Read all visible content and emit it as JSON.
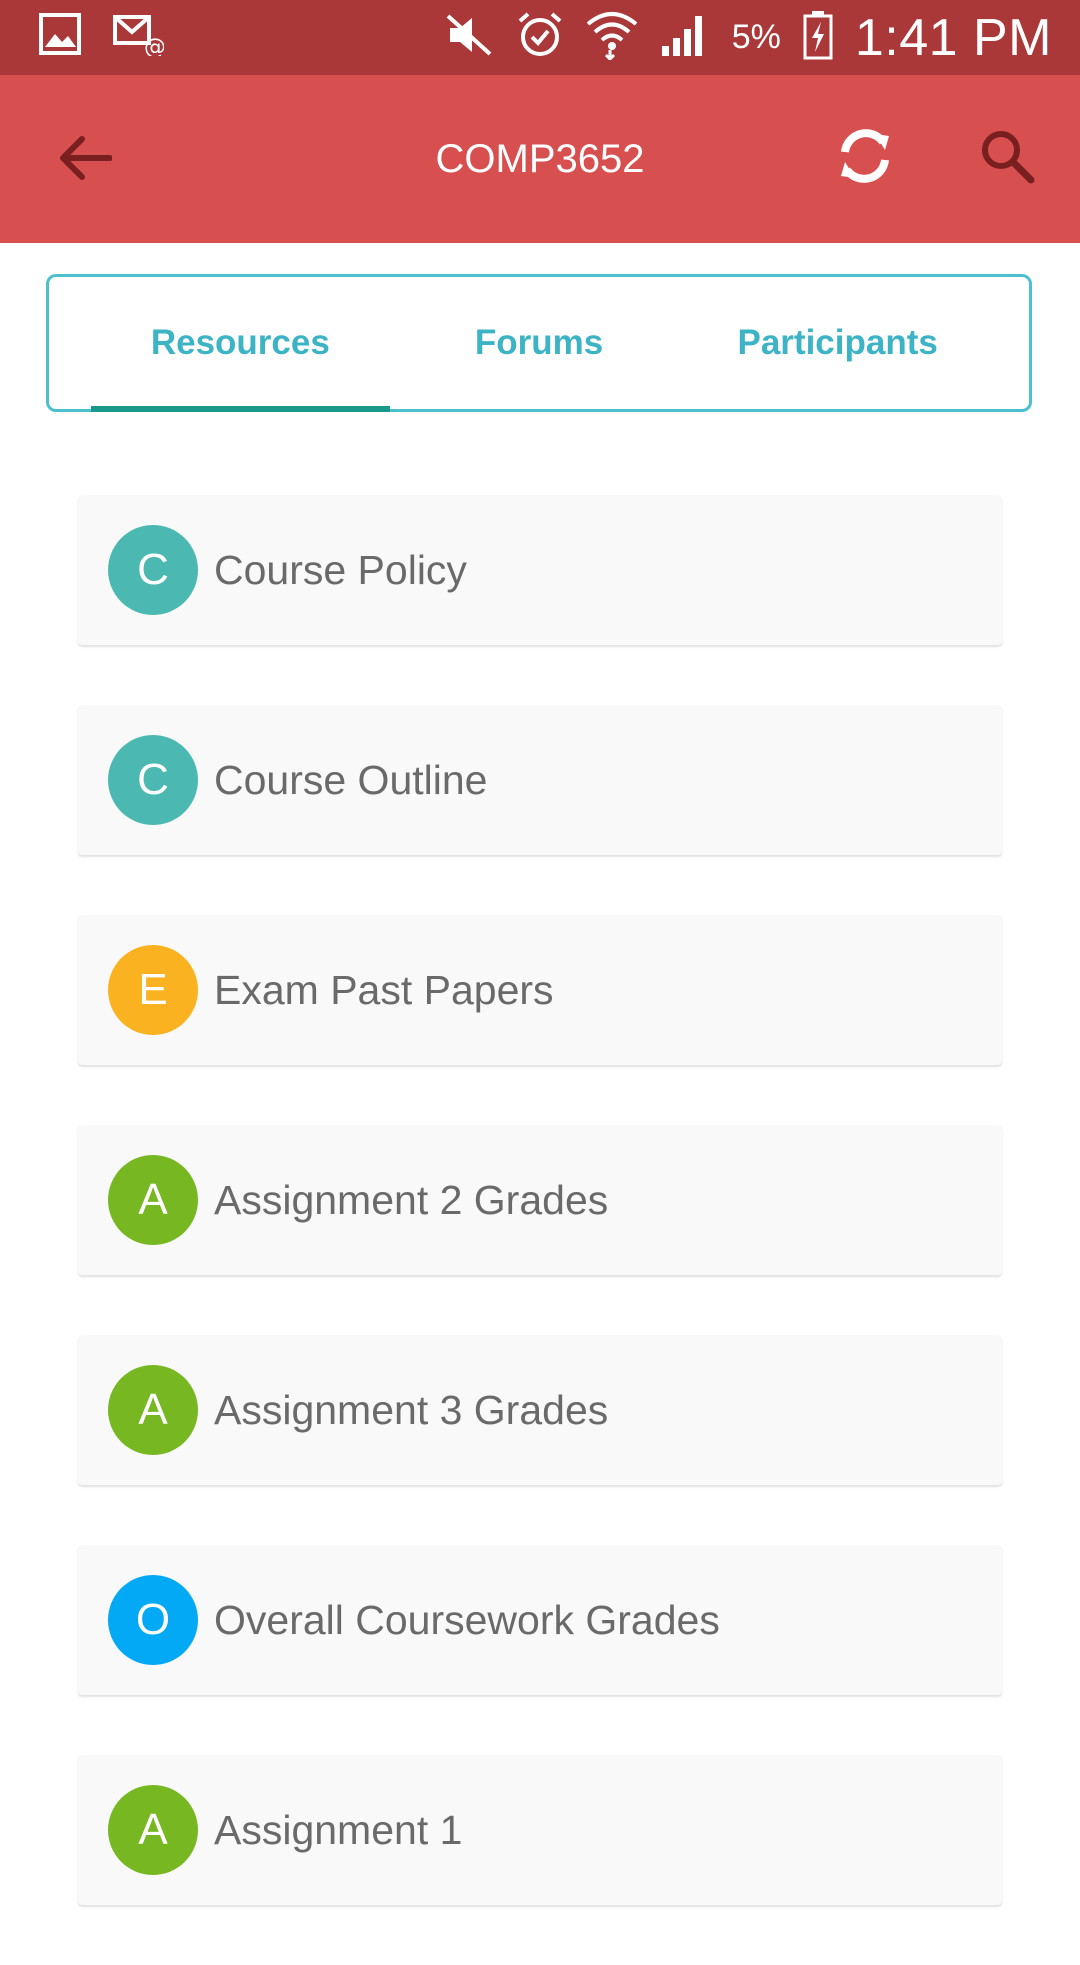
{
  "status_bar": {
    "battery_percent": "5%",
    "time": "1:41 PM",
    "icons": [
      "gallery-icon",
      "email-icon",
      "mute-icon",
      "alarm-icon",
      "wifi-icon",
      "signal-icon",
      "battery-icon"
    ]
  },
  "app_bar": {
    "title": "COMP3652",
    "icons": [
      "back-arrow-icon",
      "refresh-icon",
      "search-icon"
    ]
  },
  "tabs": [
    {
      "label": "Resources",
      "active": true
    },
    {
      "label": "Forums",
      "active": false
    },
    {
      "label": "Participants",
      "active": false
    }
  ],
  "resources": [
    {
      "letter": "C",
      "label": "Course Policy",
      "color": "#4bb9b1"
    },
    {
      "letter": "C",
      "label": "Course Outline",
      "color": "#4bb9b1"
    },
    {
      "letter": "E",
      "label": "Exam Past Papers",
      "color": "#fbb220"
    },
    {
      "letter": "A",
      "label": "Assignment 2 Grades",
      "color": "#77b722"
    },
    {
      "letter": "A",
      "label": "Assignment 3 Grades",
      "color": "#77b722"
    },
    {
      "letter": "O",
      "label": "Overall Coursework Grades",
      "color": "#03a9f4"
    },
    {
      "letter": "A",
      "label": "Assignment 1",
      "color": "#77b722"
    }
  ],
  "colors": {
    "status_bar": "#ab3838",
    "app_bar": "#d84f50",
    "tab_text": "#3db4c6",
    "tab_indicator": "#18998a"
  }
}
